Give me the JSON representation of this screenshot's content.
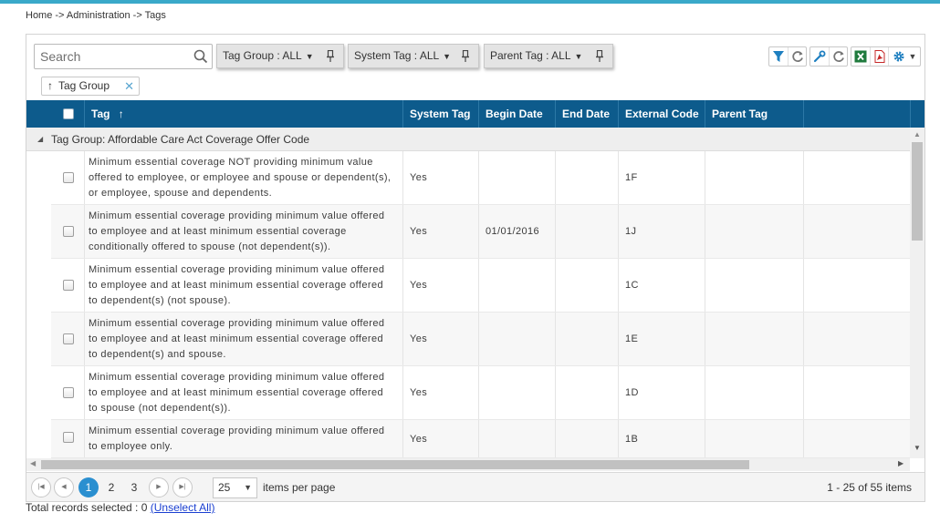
{
  "breadcrumb": "Home -> Administration -> Tags",
  "search": {
    "placeholder": "Search"
  },
  "filters": [
    {
      "label": "Tag Group : ALL"
    },
    {
      "label": "System Tag : ALL"
    },
    {
      "label": "Parent Tag : ALL"
    }
  ],
  "toolbar": {
    "icons": [
      "filter-icon",
      "refresh-icon",
      "wrench-icon",
      "refresh-icon",
      "excel-export-icon",
      "pdf-export-icon",
      "gear-icon",
      "caret-down-icon"
    ]
  },
  "group_chip": {
    "label": "Tag Group"
  },
  "columns": {
    "tag": "Tag",
    "system_tag": "System Tag",
    "begin_date": "Begin Date",
    "end_date": "End Date",
    "external_code": "External Code",
    "parent_tag": "Parent Tag"
  },
  "group_row": {
    "label": "Tag Group: Affordable Care Act Coverage Offer Code"
  },
  "rows": [
    {
      "tag": "Minimum essential coverage NOT providing minimum value offered to employee, or employee and spouse or dependent(s), or employee, spouse and dependents.",
      "system_tag": "Yes",
      "begin_date": "",
      "end_date": "",
      "external_code": "1F",
      "parent_tag": ""
    },
    {
      "tag": "Minimum essential coverage providing minimum value offered to employee and at least minimum essential coverage conditionally offered to spouse (not dependent(s)).",
      "system_tag": "Yes",
      "begin_date": "01/01/2016",
      "end_date": "",
      "external_code": "1J",
      "parent_tag": ""
    },
    {
      "tag": "Minimum essential coverage providing minimum value offered to employee and at least minimum essential coverage offered to dependent(s) (not spouse).",
      "system_tag": "Yes",
      "begin_date": "",
      "end_date": "",
      "external_code": "1C",
      "parent_tag": ""
    },
    {
      "tag": "Minimum essential coverage providing minimum value offered to employee and at least minimum essential coverage offered to dependent(s) and spouse.",
      "system_tag": "Yes",
      "begin_date": "",
      "end_date": "",
      "external_code": "1E",
      "parent_tag": ""
    },
    {
      "tag": "Minimum essential coverage providing minimum value offered to employee and at least minimum essential coverage offered to spouse (not dependent(s)).",
      "system_tag": "Yes",
      "begin_date": "",
      "end_date": "",
      "external_code": "1D",
      "parent_tag": ""
    },
    {
      "tag": "Minimum essential coverage providing minimum value offered to employee only.",
      "system_tag": "Yes",
      "begin_date": "",
      "end_date": "",
      "external_code": "1B",
      "parent_tag": ""
    }
  ],
  "pager": {
    "pages": [
      "1",
      "2",
      "3"
    ],
    "current_page": "1",
    "page_size": "25",
    "items_per_page_label": "items per page",
    "info": "1 - 25 of 55 items"
  },
  "footer": {
    "selected_text": "Total records selected : 0",
    "unselect_link": "(Unselect All)"
  }
}
